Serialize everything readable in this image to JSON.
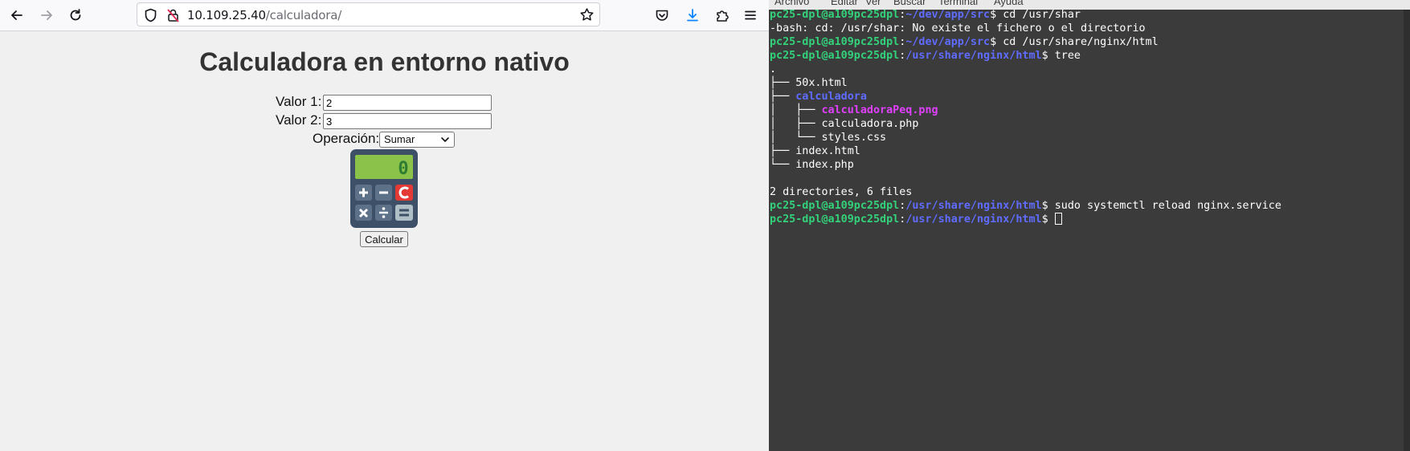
{
  "browser": {
    "url": {
      "host": "10.109.25.40",
      "path": "/calculadora/"
    },
    "page": {
      "title": "Calculadora en entorno nativo",
      "valor1_label": "Valor 1:",
      "valor1_value": "2",
      "valor2_label": "Valor 2:",
      "valor2_value": "3",
      "operacion_label": "Operación:",
      "operacion_selected": "Sumar",
      "calculator_display": "0",
      "calcular_button": "Calcular"
    }
  },
  "terminal": {
    "menu": [
      "Archivo",
      "Editar",
      "Ver",
      "Buscar",
      "Terminal",
      "Ayuda"
    ],
    "user": "pc25-dpl@a109pc25dpl",
    "lines": [
      {
        "path": "~/dev/app/src",
        "cmd": " cd /usr/shar"
      },
      {
        "text": "-bash: cd: /usr/shar: No existe el fichero o el directorio"
      },
      {
        "path": "~/dev/app/src",
        "cmd": " cd /usr/share/nginx/html"
      },
      {
        "path": "/usr/share/nginx/html",
        "cmd": " tree"
      },
      {
        "text": "."
      },
      {
        "prefix": "├── ",
        "name": "50x.html",
        "kind": "file"
      },
      {
        "prefix": "├── ",
        "name": "calculadora",
        "kind": "dir"
      },
      {
        "prefix": "│   ├── ",
        "name": "calculadoraPeq.png",
        "kind": "img"
      },
      {
        "prefix": "│   ├── ",
        "name": "calculadora.php",
        "kind": "file"
      },
      {
        "prefix": "│   └── ",
        "name": "styles.css",
        "kind": "file"
      },
      {
        "prefix": "├── ",
        "name": "index.html",
        "kind": "file"
      },
      {
        "prefix": "└── ",
        "name": "index.php",
        "kind": "file"
      },
      {
        "text": ""
      },
      {
        "text": "2 directories, 6 files"
      },
      {
        "path": "/usr/share/nginx/html",
        "cmd": " sudo systemctl reload nginx.service"
      },
      {
        "path": "/usr/share/nginx/html",
        "cmd": " ",
        "cursor": true
      }
    ]
  },
  "colors": {
    "prompt_user": "#33d17a",
    "prompt_path": "#5f6cff",
    "image_file": "#e040fb",
    "terminal_bg": "#3b3b3b"
  }
}
